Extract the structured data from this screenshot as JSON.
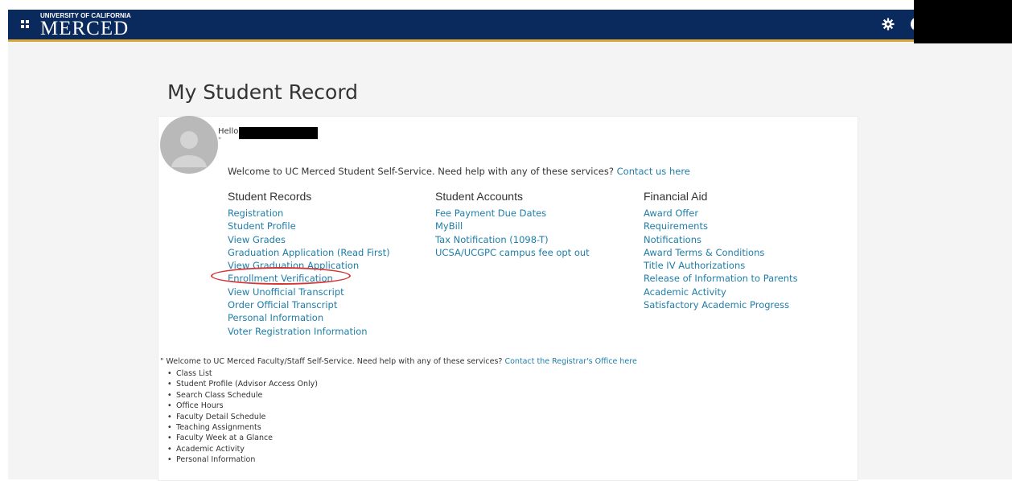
{
  "header": {
    "logo_top": "UNIVERSITY OF CALIFORNIA",
    "logo_main": "MERCED",
    "bar_color": "#0a2a5e",
    "accent_color": "#d8a93a"
  },
  "page": {
    "title": "My Student Record"
  },
  "profile": {
    "hello": "Hello",
    "sub": "\""
  },
  "welcome": {
    "text": "Welcome to UC Merced Student Self-Service. Need help with any of these services?",
    "link": "Contact us here"
  },
  "columns": [
    {
      "title": "Student Records",
      "links": [
        "Registration",
        "Student Profile",
        "View Grades",
        "Graduation Application (Read First)",
        "View Graduation Application",
        "Enrollment Verification",
        "View Unofficial Transcript",
        "Order Official Transcript",
        "Personal Information",
        "Voter Registration Information"
      ]
    },
    {
      "title": "Student Accounts",
      "links": [
        "Fee Payment Due Dates",
        "MyBill",
        "Tax Notification (1098-T)",
        "UCSA/UCGPC campus fee opt out"
      ]
    },
    {
      "title": "Financial Aid",
      "links": [
        "Award Offer",
        "Requirements",
        "Notifications",
        "Award Terms & Conditions",
        "Title IV Authorizations",
        "Release of Information to Parents",
        "Academic Activity",
        "Satisfactory Academic Progress"
      ]
    }
  ],
  "staff": {
    "text": "\" Welcome to UC Merced Faculty/Staff Self-Service. Need help with any of these services?",
    "link": "Contact the Registrar's Office here",
    "items": [
      "Class List",
      "Student Profile (Advisor Access Only)",
      "Search Class Schedule",
      "Office Hours",
      "Faculty Detail Schedule",
      "Teaching Assignments",
      "Faculty Week at a Glance",
      "Academic Activity",
      "Personal Information"
    ]
  },
  "colors": {
    "link": "#1f7ea9",
    "highlight_circle": "#d63434"
  }
}
